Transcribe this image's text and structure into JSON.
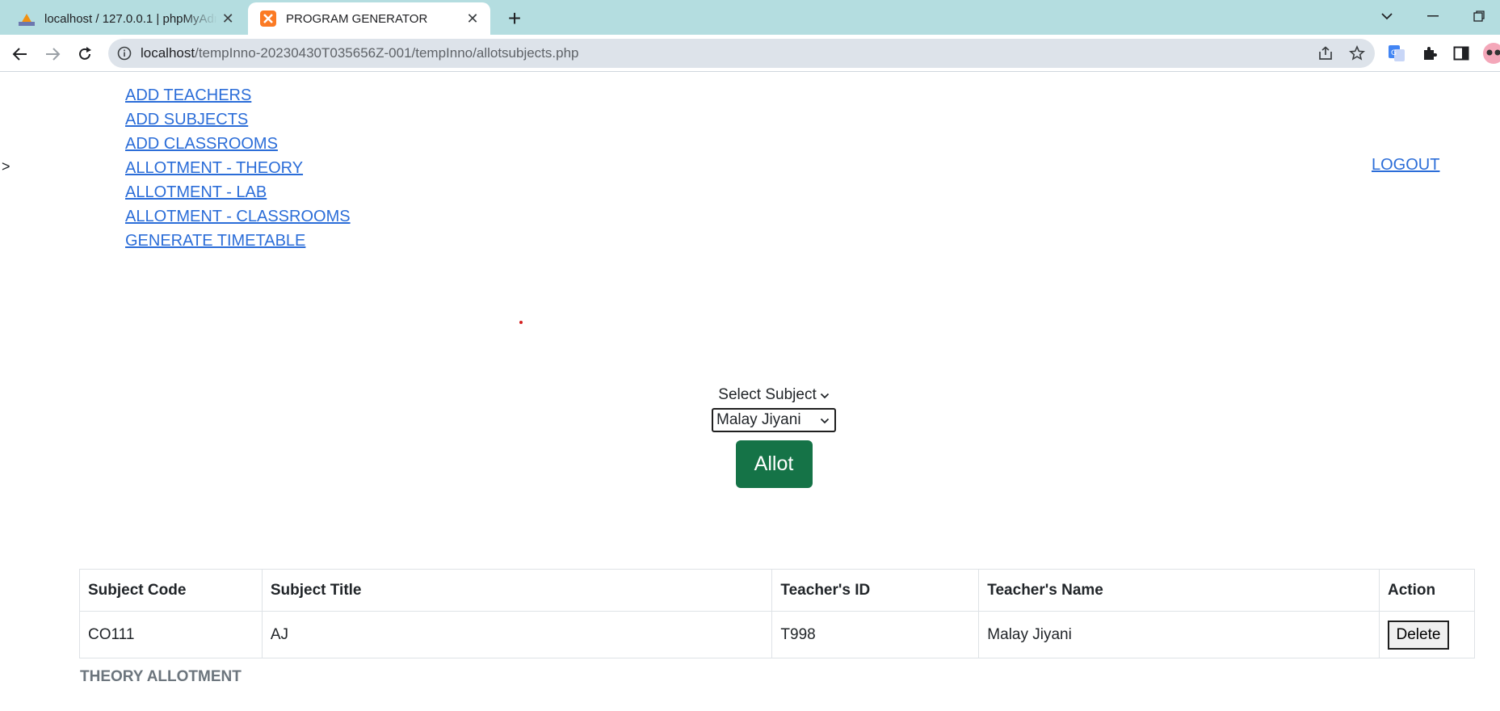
{
  "browser": {
    "tabs": [
      {
        "title": "localhost / 127.0.0.1 | phpMyAdmin",
        "active": false,
        "icon": "pma-favicon-icon"
      },
      {
        "title": "PROGRAM GENERATOR",
        "active": true,
        "icon": "xampp-favicon-icon"
      }
    ],
    "url_host": "localhost",
    "url_path": "/tempInno-20230430T035656Z-001/tempInno/allotsubjects.php",
    "accent": "#b4dde0"
  },
  "page": {
    "stray_char": ">",
    "nav_links": [
      "ADD TEACHERS",
      "ADD SUBJECTS",
      "ADD CLASSROOMS",
      "ALLOTMENT - THEORY",
      "ALLOTMENT - LAB",
      "ALLOTMENT - CLASSROOMS",
      "GENERATE TIMETABLE"
    ],
    "logout_label": "LOGOUT",
    "form": {
      "subject_select_label": "Select Subject",
      "teacher_select_value": "Malay Jiyani",
      "submit_label": "Allot",
      "submit_color": "#157347"
    },
    "table": {
      "headers": [
        "Subject Code",
        "Subject Title",
        "Teacher's ID",
        "Teacher's Name",
        "Action"
      ],
      "rows": [
        {
          "code": "CO111",
          "title": "AJ",
          "teacher_id": "T998",
          "teacher_name": "Malay Jiyani",
          "action": "Delete"
        }
      ],
      "caption": "THEORY ALLOTMENT"
    }
  }
}
